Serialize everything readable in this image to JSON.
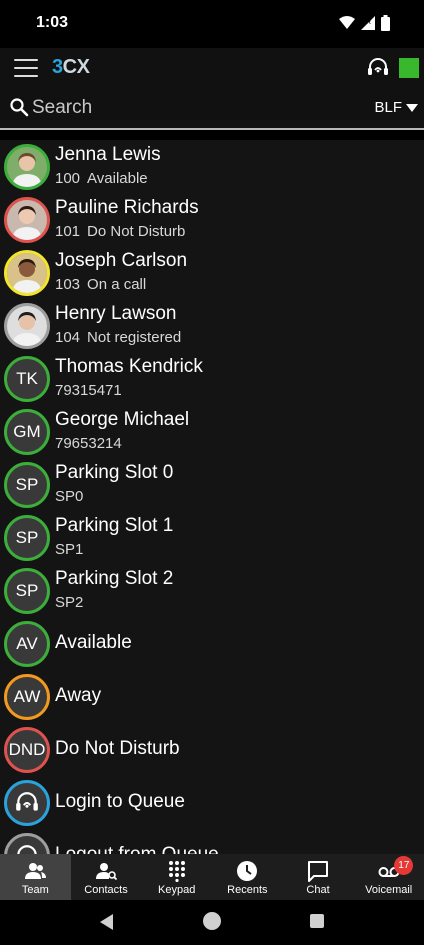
{
  "status_bar": {
    "time": "1:03"
  },
  "app_bar": {
    "logo_left": "3",
    "logo_right": "CX",
    "presence_color": "#39b82e"
  },
  "search": {
    "placeholder": "Search",
    "filter_label": "BLF"
  },
  "colors": {
    "available": "#3cae3a",
    "dnd": "#e0534d",
    "on_call": "#f2e52a",
    "not_registered": "#9e9e9e",
    "away": "#f29a1f",
    "queue": "#2aa3dc"
  },
  "contacts": [
    {
      "name": "Jenna Lewis",
      "ext": "100",
      "status": "Available",
      "avatar": "photo",
      "ring": "available"
    },
    {
      "name": "Pauline Richards",
      "ext": "101",
      "status": "Do Not Disturb",
      "avatar": "photo",
      "ring": "dnd"
    },
    {
      "name": "Joseph Carlson",
      "ext": "103",
      "status": "On a call",
      "avatar": "photo",
      "ring": "on_call"
    },
    {
      "name": "Henry Lawson",
      "ext": "104",
      "status": "Not registered",
      "avatar": "photo",
      "ring": "not_registered"
    },
    {
      "name": "Thomas Kendrick",
      "initials": "TK",
      "number": "79315471",
      "ring": "available"
    },
    {
      "name": "George Michael",
      "initials": "GM",
      "number": "79653214",
      "ring": "available"
    },
    {
      "name": "Parking Slot 0",
      "initials": "SP",
      "number": "SP0",
      "ring": "available"
    },
    {
      "name": "Parking Slot 1",
      "initials": "SP",
      "number": "SP1",
      "ring": "available"
    },
    {
      "name": "Parking Slot 2",
      "initials": "SP",
      "number": "SP2",
      "ring": "available"
    }
  ],
  "actions": [
    {
      "initials": "AV",
      "label": "Available",
      "ring": "available"
    },
    {
      "initials": "AW",
      "label": "Away",
      "ring": "away"
    },
    {
      "initials": "DND",
      "label": "Do Not Disturb",
      "ring": "dnd"
    },
    {
      "icon": "headset-icon",
      "label": "Login to Queue",
      "ring": "queue"
    },
    {
      "icon": "headset-icon",
      "label": "Logout from Queue",
      "ring": "not_registered"
    }
  ],
  "bottom_nav": {
    "tabs": [
      {
        "label": "Team",
        "icon": "team-icon",
        "active": true
      },
      {
        "label": "Contacts",
        "icon": "contacts-icon"
      },
      {
        "label": "Keypad",
        "icon": "keypad-icon"
      },
      {
        "label": "Recents",
        "icon": "clock-icon"
      },
      {
        "label": "Chat",
        "icon": "chat-icon"
      },
      {
        "label": "Voicemail",
        "icon": "voicemail-icon",
        "badge": "17"
      }
    ]
  }
}
